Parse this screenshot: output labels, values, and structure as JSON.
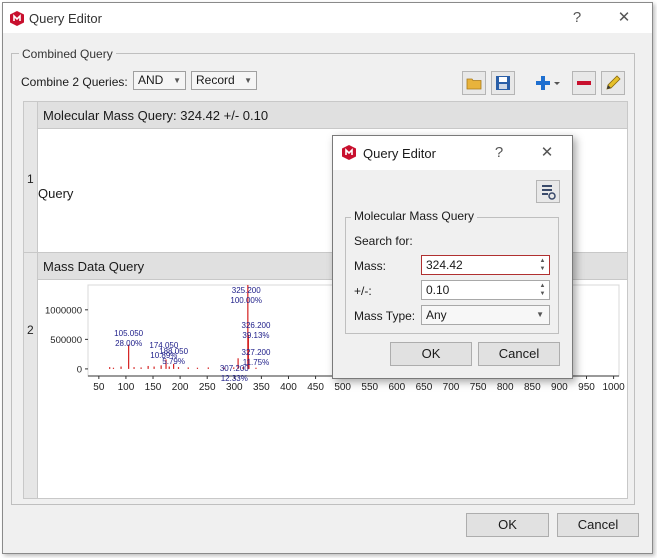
{
  "window": {
    "title": "Query Editor",
    "help": "?",
    "close": "✕"
  },
  "combined": {
    "legend": "Combined Query",
    "combine_label": "Combine 2 Queries:",
    "operator": "AND",
    "mode": "Record"
  },
  "rows": [
    {
      "num": "1",
      "header": "Molecular Mass Query: 324.42 +/- 0.10",
      "body": "Query"
    },
    {
      "num": "2",
      "header": "Mass Data Query"
    }
  ],
  "chart_data": {
    "type": "bar",
    "x_ticks": [
      "50",
      "100",
      "150",
      "200",
      "250",
      "300",
      "350",
      "400",
      "450",
      "500",
      "550",
      "600",
      "650",
      "700",
      "750",
      "800",
      "850",
      "900",
      "950",
      "1000"
    ],
    "y_ticks": [
      "1000000",
      "500000",
      "0"
    ],
    "xlim": [
      30,
      1010
    ],
    "ylim": [
      -120000,
      1420000
    ],
    "peaks": [
      {
        "x": 70,
        "y": 30000
      },
      {
        "x": 77,
        "y": 20000
      },
      {
        "x": 91,
        "y": 40000
      },
      {
        "x": 105,
        "y": 410000
      },
      {
        "x": 115,
        "y": 30000
      },
      {
        "x": 128,
        "y": 25000
      },
      {
        "x": 141,
        "y": 50000
      },
      {
        "x": 152,
        "y": 40000
      },
      {
        "x": 165,
        "y": 60000
      },
      {
        "x": 174,
        "y": 160000
      },
      {
        "x": 180,
        "y": 40000
      },
      {
        "x": 188,
        "y": 85000
      },
      {
        "x": 197,
        "y": 30000
      },
      {
        "x": 215,
        "y": 25000
      },
      {
        "x": 232,
        "y": 20000
      },
      {
        "x": 252,
        "y": 25000
      },
      {
        "x": 281,
        "y": 20000
      },
      {
        "x": 299,
        "y": 25000
      },
      {
        "x": 307,
        "y": 180000
      },
      {
        "x": 316,
        "y": 30000
      },
      {
        "x": 325,
        "y": 1475000
      },
      {
        "x": 326,
        "y": 577000
      },
      {
        "x": 327,
        "y": 173000
      },
      {
        "x": 340,
        "y": 20000
      }
    ],
    "annotations": [
      {
        "mz": "105.050",
        "pct": "28.00%"
      },
      {
        "mz": "174.050",
        "pct": "10.89%"
      },
      {
        "mz": "188.050",
        "pct": "5.79%"
      },
      {
        "mz": "307.200",
        "pct": "12.33%"
      },
      {
        "mz": "325.200",
        "pct": "100.00%"
      },
      {
        "mz": "326.200",
        "pct": "39.13%"
      },
      {
        "mz": "327.200",
        "pct": "11.75%"
      }
    ],
    "peak_color": "#d42020",
    "label_color": "#20208a"
  },
  "dialog": {
    "title": "Query Editor",
    "help": "?",
    "close": "✕",
    "group": "Molecular Mass Query",
    "search_for": "Search for:",
    "mass_label": "Mass:",
    "mass_value": "324.42",
    "tol_label": "+/-:",
    "tol_value": "0.10",
    "type_label": "Mass Type:",
    "type_value": "Any",
    "ok": "OK",
    "cancel": "Cancel"
  },
  "footer": {
    "ok": "OK",
    "cancel": "Cancel"
  },
  "colors": {
    "accent_red": "#c8102e",
    "blue": "#1e6fd0",
    "error_border": "#b03030"
  }
}
